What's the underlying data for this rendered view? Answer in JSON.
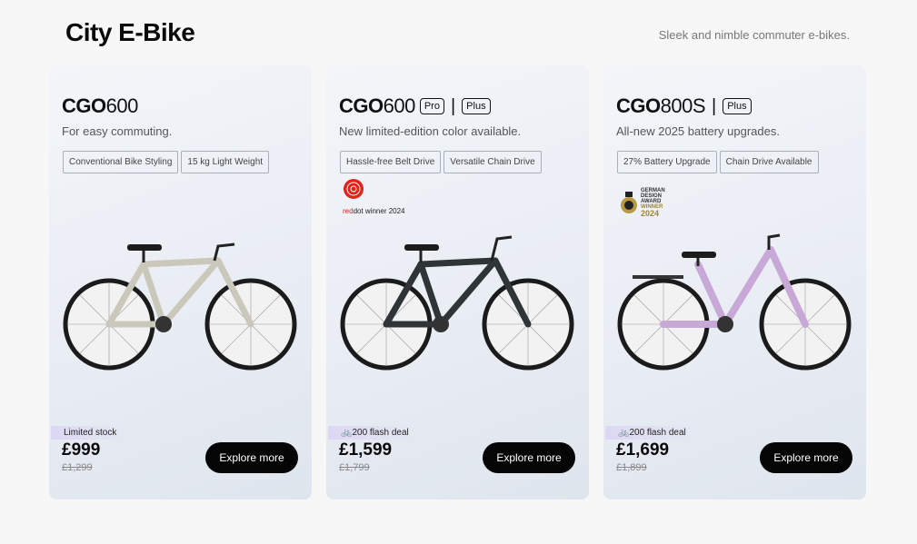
{
  "page": {
    "title": "City E-Bike",
    "subtitle": "Sleek and nimble commuter e-bikes."
  },
  "cards": [
    {
      "model_bold": "CGO",
      "model_num": "600",
      "badges": [],
      "tagline": "For easy commuting.",
      "chips": [
        "Conventional Bike Styling",
        "15 kg Light Weight"
      ],
      "award": null,
      "promo": "Limited stock",
      "price": "£999",
      "old_price": "£1,299",
      "cta": "Explore more",
      "frame_color": "#c9c8ba"
    },
    {
      "model_bold": "CGO",
      "model_num": "600",
      "badges": [
        "Pro",
        "Plus"
      ],
      "tagline": "New limited-edition color available.",
      "chips": [
        "Hassle-free Belt Drive",
        "Versatile Chain Drive"
      ],
      "award": {
        "line1": "red",
        "line1b": "dot",
        "line2": " winner 2024"
      },
      "promo": "🚲200 flash deal",
      "price": "£1,599",
      "old_price": "£1,799",
      "cta": "Explore more",
      "frame_color": "#2f3437"
    },
    {
      "model_bold": "CGO",
      "model_num": "800S",
      "badges": [
        "Plus"
      ],
      "tagline": "All-new 2025 battery upgrades.",
      "chips": [
        "27% Battery Upgrade",
        "Chain Drive Available"
      ],
      "award": {
        "gda1": "GERMAN",
        "gda2": "DESIGN",
        "gda3": "AWARD",
        "gda4": "WINNER",
        "gda_year": "2024"
      },
      "promo": "🚲200 flash deal",
      "price": "£1,699",
      "old_price": "£1,899",
      "cta": "Explore more",
      "frame_color": "#c7a8d6"
    }
  ]
}
